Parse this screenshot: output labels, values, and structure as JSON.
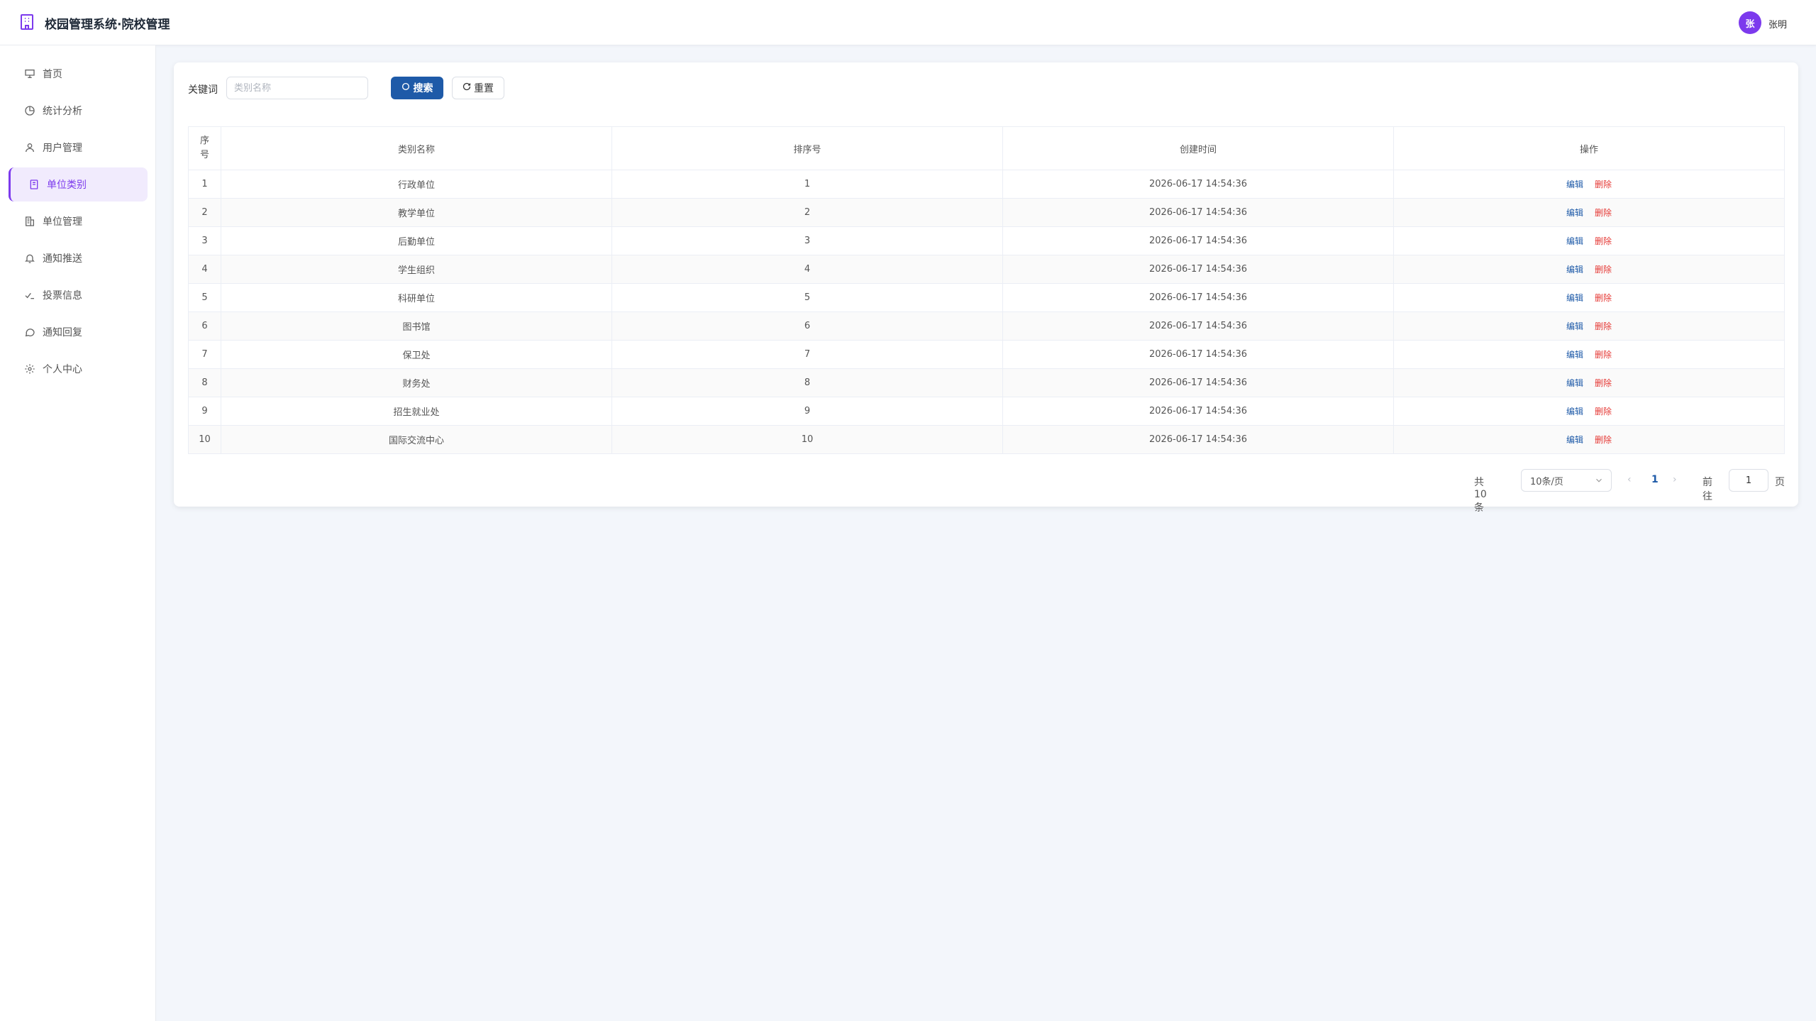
{
  "header": {
    "app_title": "校园管理系统·院校管理",
    "avatar_text": "张",
    "username": "张明"
  },
  "sidebar": {
    "items": [
      {
        "label": "首页",
        "icon": "presentation-icon"
      },
      {
        "label": "统计分析",
        "icon": "pie-chart-icon"
      },
      {
        "label": "用户管理",
        "icon": "user-icon"
      },
      {
        "label": "单位类别",
        "icon": "bookmark-icon",
        "active": true
      },
      {
        "label": "单位管理",
        "icon": "building-icon"
      },
      {
        "label": "通知推送",
        "icon": "bell-icon"
      },
      {
        "label": "投票信息",
        "icon": "vote-check-icon"
      },
      {
        "label": "通知回复",
        "icon": "message-circle-icon"
      },
      {
        "label": "个人中心",
        "icon": "gear-icon"
      }
    ]
  },
  "search": {
    "label": "关键词",
    "placeholder": "类别名称",
    "value": "",
    "search_button": "搜索",
    "reset_button": "重置"
  },
  "table": {
    "headers": [
      "序号",
      "类别名称",
      "排序号",
      "创建时间",
      "操作"
    ],
    "rows": [
      {
        "index": "1",
        "name": "行政单位",
        "sort": "1",
        "created": "2026-06-17 14:54:36"
      },
      {
        "index": "2",
        "name": "教学单位",
        "sort": "2",
        "created": "2026-06-17 14:54:36"
      },
      {
        "index": "3",
        "name": "后勤单位",
        "sort": "3",
        "created": "2026-06-17 14:54:36"
      },
      {
        "index": "4",
        "name": "学生组织",
        "sort": "4",
        "created": "2026-06-17 14:54:36"
      },
      {
        "index": "5",
        "name": "科研单位",
        "sort": "5",
        "created": "2026-06-17 14:54:36"
      },
      {
        "index": "6",
        "name": "图书馆",
        "sort": "6",
        "created": "2026-06-17 14:54:36"
      },
      {
        "index": "7",
        "name": "保卫处",
        "sort": "7",
        "created": "2026-06-17 14:54:36"
      },
      {
        "index": "8",
        "name": "财务处",
        "sort": "8",
        "created": "2026-06-17 14:54:36"
      },
      {
        "index": "9",
        "name": "招生就业处",
        "sort": "9",
        "created": "2026-06-17 14:54:36"
      },
      {
        "index": "10",
        "name": "国际交流中心",
        "sort": "10",
        "created": "2026-06-17 14:54:36"
      }
    ],
    "edit_label": "编辑",
    "delete_label": "删除"
  },
  "pagination": {
    "total": "共 10 条",
    "page_size": "10条/页",
    "current_page": "1",
    "goto_label": "前往",
    "goto_value": "1",
    "page_suffix": "页"
  },
  "colors": {
    "accent": "#7c3aed",
    "primary": "#1e5aa8",
    "danger": "#e53935"
  }
}
